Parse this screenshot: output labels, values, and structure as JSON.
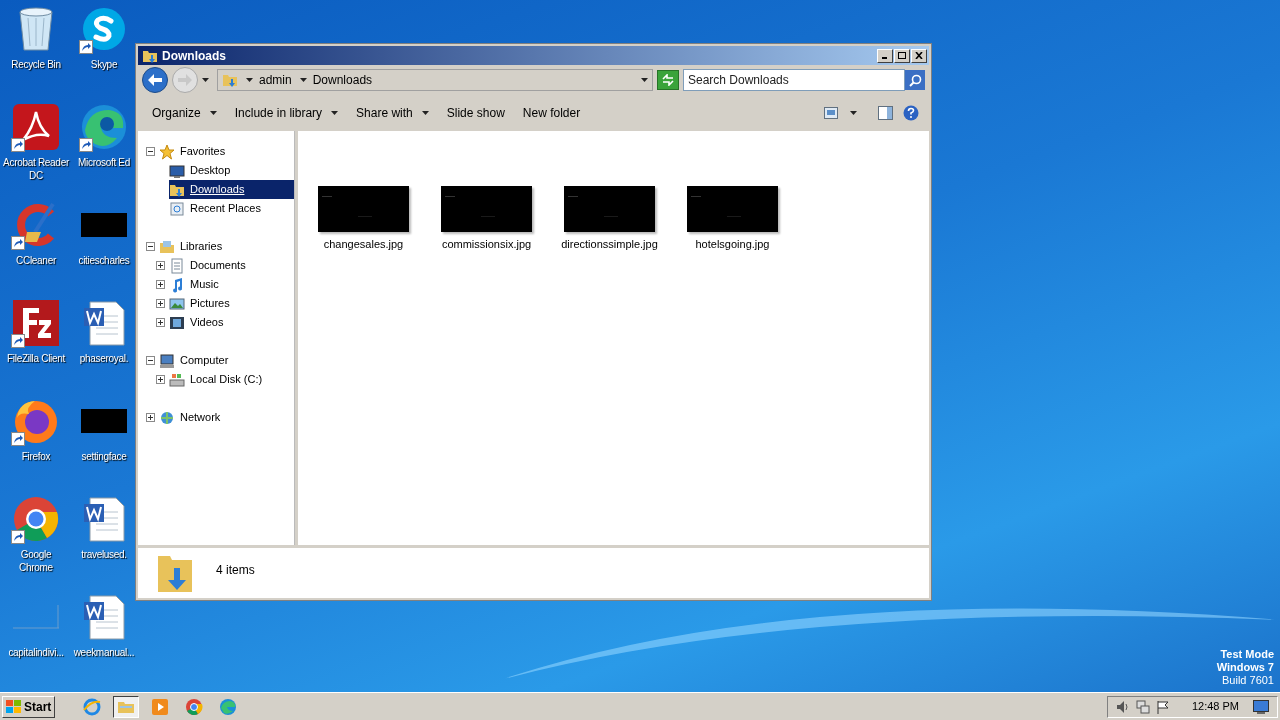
{
  "desktop_icons": [
    {
      "label": "Recycle Bin",
      "kind": "recycle",
      "shortcut": false
    },
    {
      "label": "Skype",
      "kind": "skype",
      "shortcut": true
    },
    {
      "label": "Acrobat Reader DC",
      "kind": "acrobat",
      "shortcut": true
    },
    {
      "label": "Microsoft Ed",
      "kind": "edge",
      "shortcut": true
    },
    {
      "label": "CCleaner",
      "kind": "ccleaner",
      "shortcut": true
    },
    {
      "label": "citiescharles",
      "kind": "black",
      "shortcut": false
    },
    {
      "label": "FileZilla Client",
      "kind": "filezilla",
      "shortcut": true
    },
    {
      "label": "phaseroyal.",
      "kind": "word",
      "shortcut": false
    },
    {
      "label": "Firefox",
      "kind": "firefox",
      "shortcut": true
    },
    {
      "label": "settingface",
      "kind": "black",
      "shortcut": false
    },
    {
      "label": "Google Chrome",
      "kind": "chrome",
      "shortcut": true
    },
    {
      "label": "travelused.",
      "kind": "word",
      "shortcut": false
    },
    {
      "label": "capitalindivi...",
      "kind": "blank",
      "shortcut": false
    },
    {
      "label": "weekmanual...",
      "kind": "word",
      "shortcut": false
    }
  ],
  "window": {
    "title": "Downloads",
    "breadcrumb": [
      "admin",
      "Downloads"
    ],
    "search": {
      "placeholder": "Search Downloads"
    },
    "toolbar": [
      {
        "label": "Organize",
        "menu": true
      },
      {
        "label": "Include in library",
        "menu": true
      },
      {
        "label": "Share with",
        "menu": true
      },
      {
        "label": "Slide show",
        "menu": false
      },
      {
        "label": "New folder",
        "menu": false
      }
    ],
    "nav": [
      {
        "label": "Favorites",
        "kind": "star",
        "expanded": true,
        "selected": false,
        "children": [
          {
            "label": "Desktop",
            "kind": "desktop",
            "selected": false
          },
          {
            "label": "Downloads",
            "kind": "downloads",
            "selected": true
          },
          {
            "label": "Recent Places",
            "kind": "recent",
            "selected": false
          }
        ]
      },
      {
        "label": "Libraries",
        "kind": "library",
        "expanded": true,
        "selected": false,
        "children": [
          {
            "label": "Documents",
            "kind": "documents",
            "expanded": false,
            "selected": false
          },
          {
            "label": "Music",
            "kind": "music",
            "expanded": false,
            "selected": false
          },
          {
            "label": "Pictures",
            "kind": "pictures",
            "expanded": false,
            "selected": false
          },
          {
            "label": "Videos",
            "kind": "videos",
            "expanded": false,
            "selected": false
          }
        ]
      },
      {
        "label": "Computer",
        "kind": "computer",
        "expanded": true,
        "selected": false,
        "children": [
          {
            "label": "Local Disk (C:)",
            "kind": "disk",
            "expanded": false,
            "selected": false
          }
        ]
      },
      {
        "label": "Network",
        "kind": "network",
        "expanded": false,
        "selected": false
      }
    ],
    "files": [
      {
        "name": "changesales.jpg",
        "kind": "picture"
      },
      {
        "name": "commissionsix.jpg",
        "kind": "picture"
      },
      {
        "name": "directionssimple.jpg",
        "kind": "picture"
      },
      {
        "name": "hotelsgoing.jpg",
        "kind": "picture"
      }
    ],
    "status": "4 items"
  },
  "watermark_text": [
    "Test Mode",
    "Windows 7",
    "Build 7601"
  ],
  "taskbar": {
    "start": "Start",
    "apps": [
      {
        "kind": "ie",
        "selected": false
      },
      {
        "kind": "explorer",
        "selected": true
      },
      {
        "kind": "media",
        "selected": false
      },
      {
        "kind": "chrome",
        "selected": false
      },
      {
        "kind": "edge",
        "selected": false
      }
    ],
    "clock": "12:48 PM"
  }
}
